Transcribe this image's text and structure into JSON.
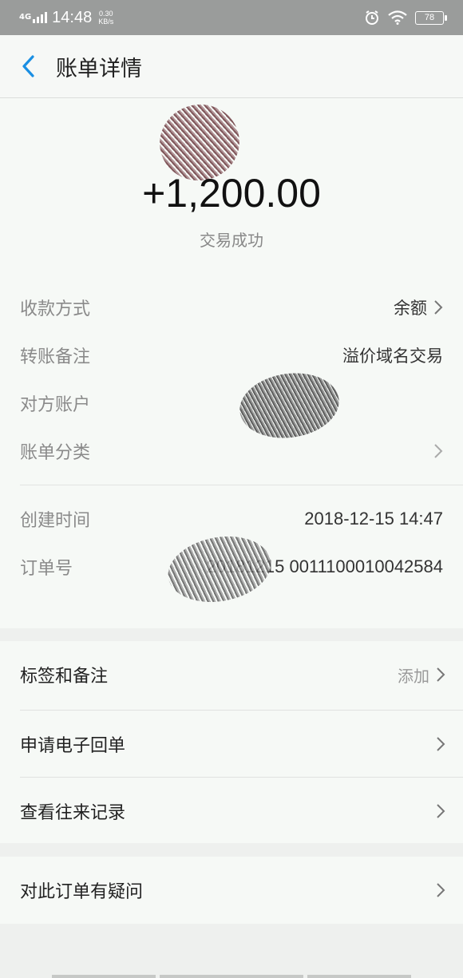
{
  "status_bar": {
    "network": "4G",
    "time": "14:48",
    "speed_value": "0.30",
    "speed_unit": "KB/s",
    "battery": "78"
  },
  "header": {
    "title": "账单详情",
    "back_icon": "chevron-left-icon"
  },
  "summary": {
    "amount": "+1,200.00",
    "status": "交易成功"
  },
  "details": [
    {
      "label": "收款方式",
      "value": "余额",
      "chevron": true
    },
    {
      "label": "转账备注",
      "value": "溢价域名交易",
      "chevron": false
    },
    {
      "label": "对方账户",
      "value": "",
      "chevron": false
    },
    {
      "label": "账单分类",
      "value": "",
      "chevron": true
    }
  ],
  "meta": [
    {
      "label": "创建时间",
      "value": "2018-12-15 14:47"
    },
    {
      "label": "订单号",
      "value": "20181215 0011100010042584"
    }
  ],
  "menu": {
    "tags": {
      "label": "标签和备注",
      "action": "添加"
    },
    "receipt": {
      "label": "申请电子回单"
    },
    "history": {
      "label": "查看往来记录"
    },
    "question": {
      "label": "对此订单有疑问"
    }
  },
  "colors": {
    "accent": "#1a8fe3",
    "statusbar": "#9a9c9b",
    "background": "#eef0ee"
  }
}
